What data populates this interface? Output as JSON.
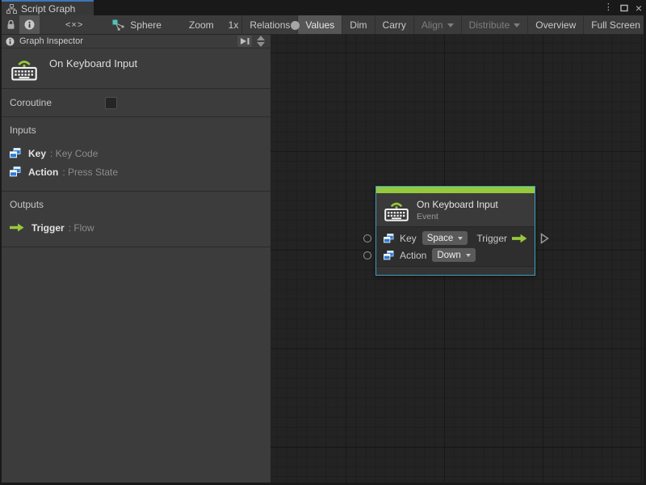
{
  "colors": {
    "accent-green": "#96C83E",
    "selection-teal": "#3E9FBD",
    "port-blue": "#2D7CD6"
  },
  "window": {
    "tab_label": "Script Graph",
    "controls": {
      "more": "⋮",
      "close": "×"
    }
  },
  "toolbar": {
    "code_glyph": "<×>",
    "selection_label": "Sphere",
    "zoom_label": "Zoom",
    "zoom_value": "1x",
    "actions": [
      {
        "label": "Relations",
        "state": "normal"
      },
      {
        "label": "Values",
        "state": "active"
      },
      {
        "label": "Dim",
        "state": "normal"
      },
      {
        "label": "Carry",
        "state": "normal"
      },
      {
        "label": "Align",
        "state": "disabled",
        "dropdown": true
      },
      {
        "label": "Distribute",
        "state": "disabled",
        "dropdown": true
      },
      {
        "label": "Overview",
        "state": "normal"
      },
      {
        "label": "Full Screen",
        "state": "normal"
      }
    ]
  },
  "inspector": {
    "header_title": "Graph Inspector",
    "unit_title": "On Keyboard Input",
    "coroutine_label": "Coroutine",
    "coroutine_checked": false,
    "inputs": {
      "title": "Inputs",
      "rows": [
        {
          "name": "Key",
          "type": ": Key Code"
        },
        {
          "name": "Action",
          "type": ": Press State"
        }
      ]
    },
    "outputs": {
      "title": "Outputs",
      "rows": [
        {
          "name": "Trigger",
          "type": ": Flow"
        }
      ]
    }
  },
  "node": {
    "title": "On Keyboard Input",
    "subtitle": "Event",
    "rows": [
      {
        "label": "Key",
        "value": "Space",
        "output": "Trigger"
      },
      {
        "label": "Action",
        "value": "Down"
      }
    ]
  }
}
